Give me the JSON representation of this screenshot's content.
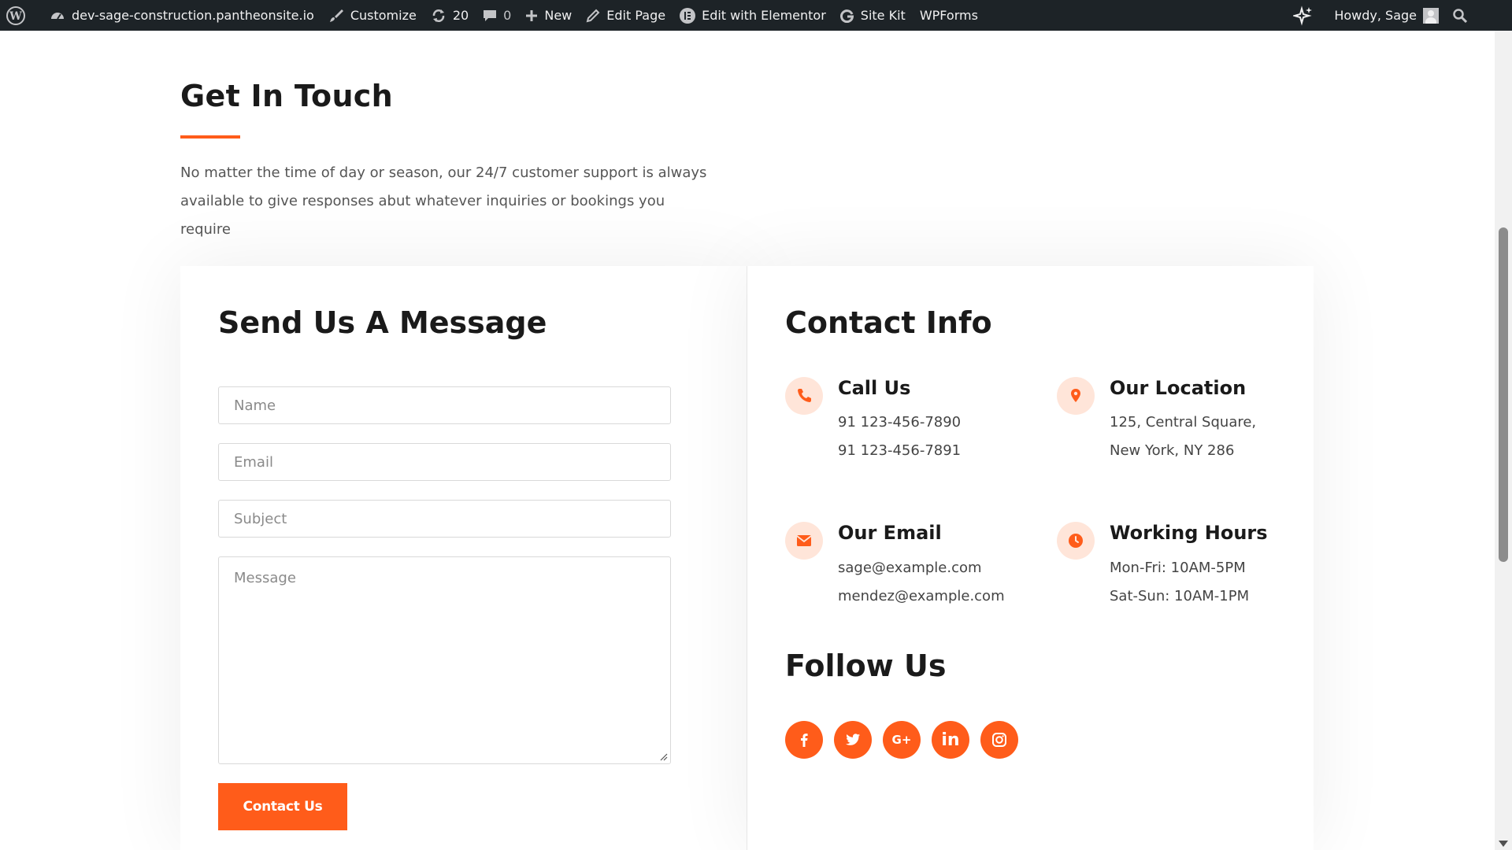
{
  "adminbar": {
    "site": "dev-sage-construction.pantheonsite.io",
    "customize": "Customize",
    "updates": "20",
    "comments": "0",
    "new": "New",
    "edit_page": "Edit Page",
    "edit_elementor": "Edit with Elementor",
    "site_kit": "Site Kit",
    "wpforms": "WPForms",
    "howdy": "Howdy, Sage"
  },
  "hero": {
    "title": "Get In Touch",
    "description": "No matter the time of day  or season, our 24/7 customer support is always available to give responses abut whatever inquiries or bookings you require"
  },
  "form": {
    "title": "Send Us A Message",
    "name_placeholder": "Name",
    "email_placeholder": "Email",
    "subject_placeholder": "Subject",
    "message_placeholder": "Message",
    "submit_label": "Contact Us"
  },
  "contact": {
    "title": "Contact Info",
    "call": {
      "title": "Call Us",
      "lines": [
        "91 123-456-7890",
        "91 123-456-7891"
      ],
      "icon": "phone-icon"
    },
    "location": {
      "title": "Our Location",
      "lines": [
        "125, Central Square,",
        "New York, NY 286"
      ],
      "icon": "map-pin-icon"
    },
    "email": {
      "title": "Our Email",
      "lines": [
        "sage@example.com",
        "mendez@example.com"
      ],
      "icon": "envelope-icon"
    },
    "hours": {
      "title": "Working Hours",
      "lines": [
        "Mon-Fri: 10AM-5PM",
        "Sat-Sun: 10AM-1PM"
      ],
      "icon": "clock-icon"
    }
  },
  "follow": {
    "title": "Follow Us",
    "networks": [
      "facebook-icon",
      "twitter-icon",
      "google-plus-icon",
      "linkedin-icon",
      "instagram-icon"
    ],
    "google_plus_glyph": "G+",
    "linkedin_glyph": "in"
  },
  "colors": {
    "accent": "#ff5c1a",
    "accent_light": "#ffe5d9",
    "adminbar": "#1d2327"
  }
}
